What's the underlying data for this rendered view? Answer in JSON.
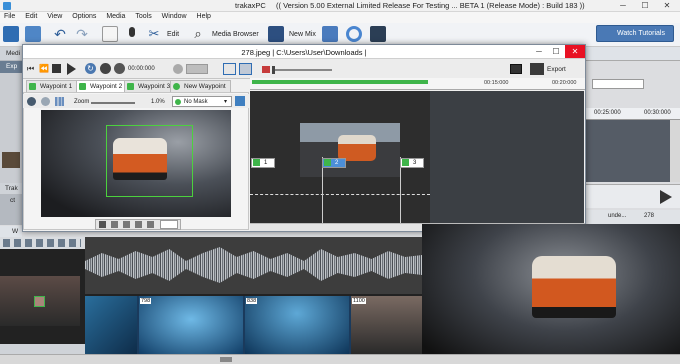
{
  "app": {
    "title": "trakaxPC",
    "title_suffix": "((  Version 5.00 External Limited Release For Testing ...  BETA 1  (Release Mode) : Build 183  ))"
  },
  "menu": [
    "File",
    "Edit",
    "View",
    "Options",
    "Media",
    "Tools",
    "Window",
    "Help"
  ],
  "toolbar": {
    "edit_label": "Edit",
    "media_browser_label": "Media Browser",
    "new_mix_label": "New Mix",
    "watch_tutorials_label": "Watch Tutorials"
  },
  "dialog": {
    "title": "278.jpeg    |  C:\\Users\\User\\Downloads  |",
    "time_display": "00:00:000",
    "export_label": "Export",
    "tabs": [
      "Waypoint 1",
      "Waypoint 2",
      "Waypoint 3",
      "New Waypoint"
    ],
    "zoom_label": "Zoom",
    "zoom_value": "1.0%",
    "mask_label": "No Mask",
    "ruler_ticks": [
      "00:00",
      "00:05:000",
      "00:10:000",
      "00:15:000",
      "00:20:000"
    ],
    "waypoints": [
      "1",
      "2",
      "3"
    ]
  },
  "background": {
    "left_labels": [
      "Medi",
      "Exp",
      "Trak",
      "ct",
      "W"
    ],
    "right_ticks": [
      "00:25:000",
      "00:30:000"
    ],
    "clip_label": "unde...",
    "clip_number": "278",
    "film_markers": [
      "798",
      "838",
      "1100"
    ]
  },
  "colors": {
    "accent_blue": "#4a79b5",
    "waypoint_green": "#3fb54a",
    "close_red": "#e81123"
  }
}
